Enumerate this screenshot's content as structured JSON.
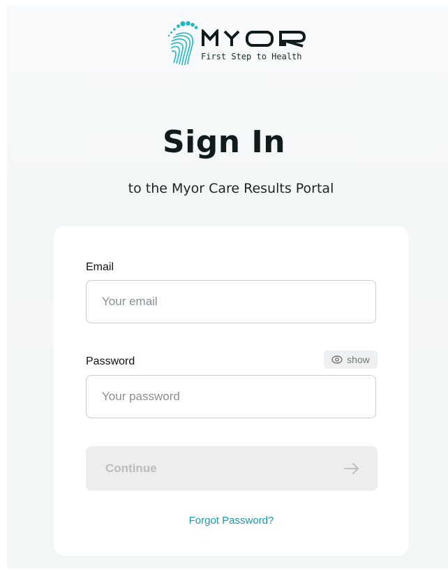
{
  "brand": {
    "name": "MYOR",
    "tagline": "First Step to Health",
    "accent_color": "#1fb8c3",
    "text_color": "#111b1d"
  },
  "heading": {
    "title": "Sign In",
    "subtitle": "to the Myor Care Results Portal"
  },
  "form": {
    "email": {
      "label": "Email",
      "placeholder": "Your email",
      "value": ""
    },
    "password": {
      "label": "Password",
      "placeholder": "Your password",
      "value": "",
      "show_toggle_label": "show",
      "show_toggle_icon": "eye-icon"
    },
    "continue_button": {
      "label": "Continue",
      "icon": "arrow-right-icon",
      "state": "disabled"
    },
    "forgot_password_link": "Forgot Password?"
  }
}
